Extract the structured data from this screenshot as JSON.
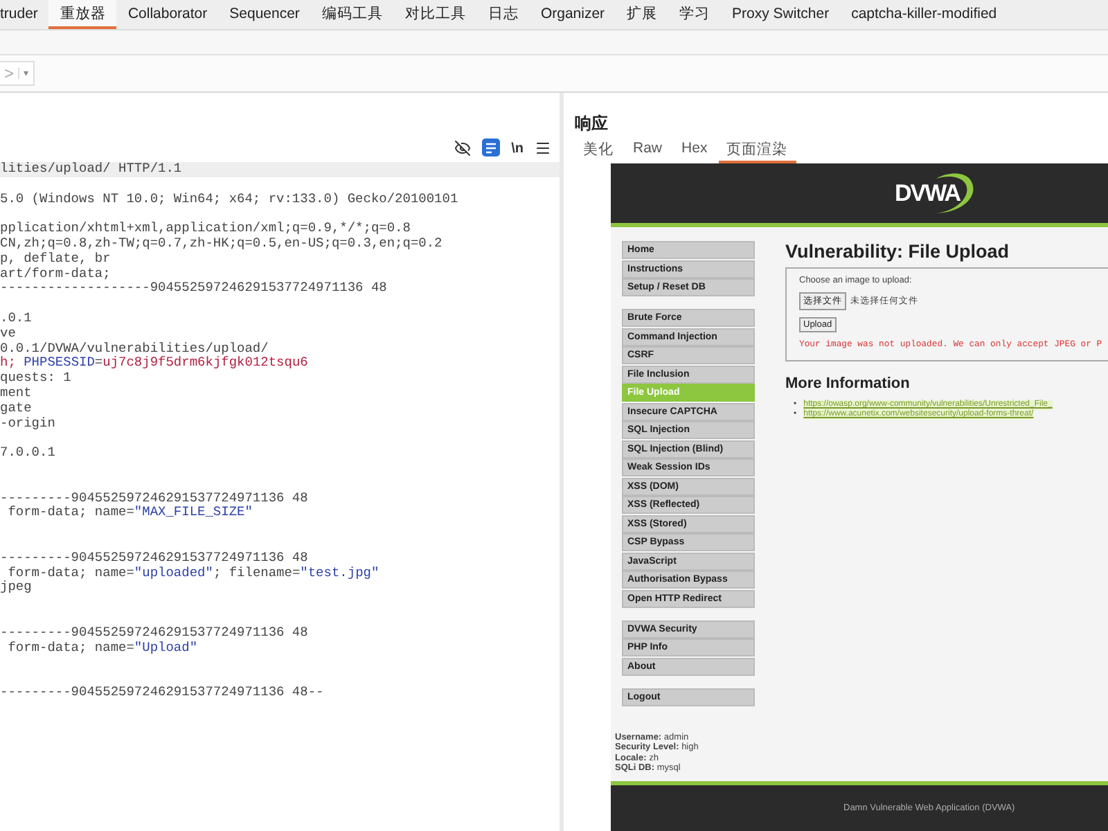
{
  "top_tabs": [
    {
      "label": "truder",
      "selected": false
    },
    {
      "label": "重放器",
      "selected": true
    },
    {
      "label": "Collaborator",
      "selected": false
    },
    {
      "label": "Sequencer",
      "selected": false
    },
    {
      "label": "编码工具",
      "selected": false
    },
    {
      "label": "对比工具",
      "selected": false
    },
    {
      "label": "日志",
      "selected": false
    },
    {
      "label": "Organizer",
      "selected": false
    },
    {
      "label": "扩展",
      "selected": false
    },
    {
      "label": "学习",
      "selected": false
    },
    {
      "label": "Proxy Switcher",
      "selected": false
    },
    {
      "label": "captcha-killer-modified",
      "selected": false
    }
  ],
  "nav": {
    "forward": ">",
    "forward_disabled": true,
    "dropdown": "▾"
  },
  "request": {
    "toolbar": {
      "layout_toggle_on": true,
      "newline_button": "\\n"
    },
    "lines": [
      {
        "kind": "text",
        "current": true,
        "segments": [
          {
            "kind": "plain",
            "text": "lities/upload/ HTTP/1.1"
          }
        ]
      },
      {
        "kind": "blank",
        "current": false
      },
      {
        "kind": "text",
        "current": false,
        "segments": [
          {
            "kind": "plain",
            "text": "5.0 (Windows NT 10.0; Win64; x64; rv:133.0) Gecko/20100101"
          }
        ]
      },
      {
        "kind": "blank",
        "current": false
      },
      {
        "kind": "text",
        "current": false,
        "segments": [
          {
            "kind": "plain",
            "text": "pplication/xhtml+xml,application/xml;q=0.9,*/*;q=0.8"
          }
        ]
      },
      {
        "kind": "text",
        "current": false,
        "segments": [
          {
            "kind": "plain",
            "text": "CN,zh;q=0.8,zh-TW;q=0.7,zh-HK;q=0.5,en-US;q=0.3,en;q=0.2"
          }
        ]
      },
      {
        "kind": "text",
        "current": false,
        "segments": [
          {
            "kind": "plain",
            "text": "p, deflate, br"
          }
        ]
      },
      {
        "kind": "text",
        "current": false,
        "segments": [
          {
            "kind": "plain",
            "text": "art/form-data;"
          }
        ]
      },
      {
        "kind": "text",
        "current": false,
        "segments": [
          {
            "kind": "plain",
            "text": "-------------------904552597246291537724971136 48"
          }
        ]
      },
      {
        "kind": "blank",
        "current": false
      },
      {
        "kind": "text",
        "current": false,
        "segments": [
          {
            "kind": "plain",
            "text": ".0.1"
          }
        ]
      },
      {
        "kind": "text",
        "current": false,
        "segments": [
          {
            "kind": "plain",
            "text": "ve"
          }
        ]
      },
      {
        "kind": "text",
        "current": false,
        "segments": [
          {
            "kind": "plain",
            "text": "0.0.1/DVWA/vulnerabilities/upload/"
          }
        ]
      },
      {
        "kind": "text",
        "current": false,
        "segments": [
          {
            "kind": "value",
            "text": "h; "
          },
          {
            "kind": "name",
            "text": "PHPSESSID"
          },
          {
            "kind": "plain",
            "text": "="
          },
          {
            "kind": "value",
            "text": "uj7c8j9f5drm6kjfgk012tsqu6"
          }
        ]
      },
      {
        "kind": "text",
        "current": false,
        "segments": [
          {
            "kind": "plain",
            "text": "quests: 1"
          }
        ]
      },
      {
        "kind": "text",
        "current": false,
        "segments": [
          {
            "kind": "plain",
            "text": "ment"
          }
        ]
      },
      {
        "kind": "text",
        "current": false,
        "segments": [
          {
            "kind": "plain",
            "text": "gate"
          }
        ]
      },
      {
        "kind": "text",
        "current": false,
        "segments": [
          {
            "kind": "plain",
            "text": "-origin"
          }
        ]
      },
      {
        "kind": "blank",
        "current": false
      },
      {
        "kind": "text",
        "current": false,
        "segments": [
          {
            "kind": "plain",
            "text": "7.0.0.1"
          }
        ]
      },
      {
        "kind": "blank",
        "current": false
      },
      {
        "kind": "blank",
        "current": false
      },
      {
        "kind": "text",
        "current": false,
        "segments": [
          {
            "kind": "plain",
            "text": "---------904552597246291537724971136 48"
          }
        ]
      },
      {
        "kind": "text",
        "current": false,
        "segments": [
          {
            "kind": "plain",
            "text": " form-data; name="
          },
          {
            "kind": "name",
            "text": "\"MAX_FILE_SIZE\""
          }
        ]
      },
      {
        "kind": "blank",
        "current": false
      },
      {
        "kind": "blank",
        "current": false
      },
      {
        "kind": "text",
        "current": false,
        "segments": [
          {
            "kind": "plain",
            "text": "---------904552597246291537724971136 48"
          }
        ]
      },
      {
        "kind": "text",
        "current": false,
        "segments": [
          {
            "kind": "plain",
            "text": " form-data; name="
          },
          {
            "kind": "name",
            "text": "\"uploaded\""
          },
          {
            "kind": "plain",
            "text": "; filename="
          },
          {
            "kind": "name",
            "text": "\"test.jpg\""
          }
        ]
      },
      {
        "kind": "text",
        "current": false,
        "segments": [
          {
            "kind": "plain",
            "text": "jpeg"
          }
        ]
      },
      {
        "kind": "blank",
        "current": false
      },
      {
        "kind": "blank",
        "current": false
      },
      {
        "kind": "text",
        "current": false,
        "segments": [
          {
            "kind": "plain",
            "text": "---------904552597246291537724971136 48"
          }
        ]
      },
      {
        "kind": "text",
        "current": false,
        "segments": [
          {
            "kind": "plain",
            "text": " form-data; name="
          },
          {
            "kind": "name",
            "text": "\"Upload\""
          }
        ]
      },
      {
        "kind": "blank",
        "current": false
      },
      {
        "kind": "blank",
        "current": false
      },
      {
        "kind": "text",
        "current": false,
        "segments": [
          {
            "kind": "plain",
            "text": "---------904552597246291537724971136 48--"
          }
        ]
      }
    ]
  },
  "response": {
    "title": "响应",
    "tabs": [
      {
        "label": "美化",
        "selected": false
      },
      {
        "label": "Raw",
        "selected": false
      },
      {
        "label": "Hex",
        "selected": false
      },
      {
        "label": "页面渲染",
        "selected": true
      }
    ],
    "page": {
      "logo": "DVWA",
      "menu_groups": [
        [
          {
            "label": "Home",
            "selected": false
          },
          {
            "label": "Instructions",
            "selected": false
          },
          {
            "label": "Setup / Reset DB",
            "selected": false
          }
        ],
        [
          {
            "label": "Brute Force",
            "selected": false
          },
          {
            "label": "Command Injection",
            "selected": false
          },
          {
            "label": "CSRF",
            "selected": false
          },
          {
            "label": "File Inclusion",
            "selected": false
          },
          {
            "label": "File Upload",
            "selected": true
          },
          {
            "label": "Insecure CAPTCHA",
            "selected": false
          },
          {
            "label": "SQL Injection",
            "selected": false
          },
          {
            "label": "SQL Injection (Blind)",
            "selected": false
          },
          {
            "label": "Weak Session IDs",
            "selected": false
          },
          {
            "label": "XSS (DOM)",
            "selected": false
          },
          {
            "label": "XSS (Reflected)",
            "selected": false
          },
          {
            "label": "XSS (Stored)",
            "selected": false
          },
          {
            "label": "CSP Bypass",
            "selected": false
          },
          {
            "label": "JavaScript",
            "selected": false
          },
          {
            "label": "Authorisation Bypass",
            "selected": false
          },
          {
            "label": "Open HTTP Redirect",
            "selected": false
          }
        ],
        [
          {
            "label": "DVWA Security",
            "selected": false
          },
          {
            "label": "PHP Info",
            "selected": false
          },
          {
            "label": "About",
            "selected": false
          }
        ],
        [
          {
            "label": "Logout",
            "selected": false
          }
        ]
      ],
      "user_info": [
        {
          "label": "Username:",
          "value": "admin"
        },
        {
          "label": "Security Level:",
          "value": "high"
        },
        {
          "label": "Locale:",
          "value": "zh"
        },
        {
          "label": "SQLi DB:",
          "value": "mysql"
        }
      ],
      "heading": "Vulnerability: File Upload",
      "form": {
        "prompt": "Choose an image to upload:",
        "file_button": "选择文件",
        "file_status": "未选择任何文件",
        "submit": "Upload",
        "error": "Your image was not uploaded. We can only accept JPEG or P"
      },
      "more_heading": "More Information",
      "links": [
        {
          "marker": "•",
          "url": "https://owasp.org/www-community/vulnerabilities/Unrestricted_File_"
        },
        {
          "marker": "•",
          "url": "https://www.acunetix.com/websitesecurity/upload-forms-threat/"
        }
      ],
      "footer": "Damn Vulnerable Web Application (DVWA)"
    }
  }
}
